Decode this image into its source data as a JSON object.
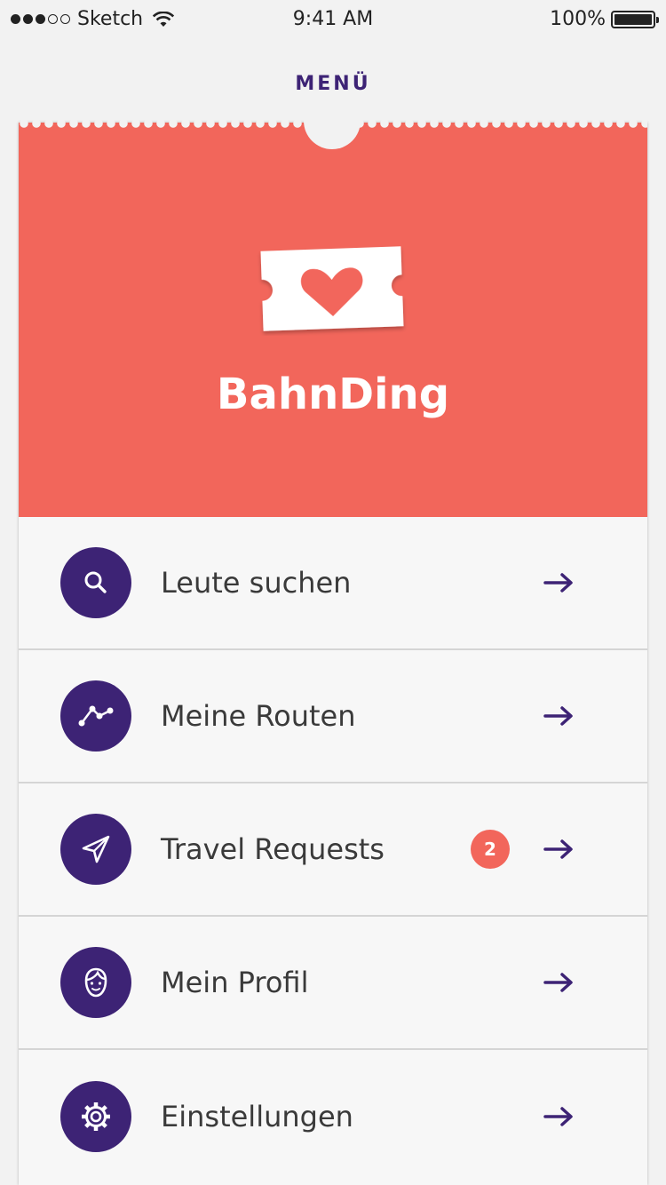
{
  "status_bar": {
    "carrier": "Sketch",
    "time": "9:41 AM",
    "battery": "100%"
  },
  "header": {
    "title": "MENÜ"
  },
  "hero": {
    "app_name": "BahnDing",
    "logo_icon": "ticket-heart-icon"
  },
  "menu": {
    "items": [
      {
        "label": "Leute suchen",
        "icon": "search-icon"
      },
      {
        "label": "Meine Routen",
        "icon": "route-icon"
      },
      {
        "label": "Travel Requests",
        "icon": "paper-plane-icon",
        "badge": "2"
      },
      {
        "label": "Mein Profil",
        "icon": "profile-face-icon"
      },
      {
        "label": "Einstellungen",
        "icon": "gear-icon"
      }
    ]
  },
  "colors": {
    "accent": "#f2665b",
    "primary": "#3d2375",
    "background": "#f2f2f2"
  }
}
